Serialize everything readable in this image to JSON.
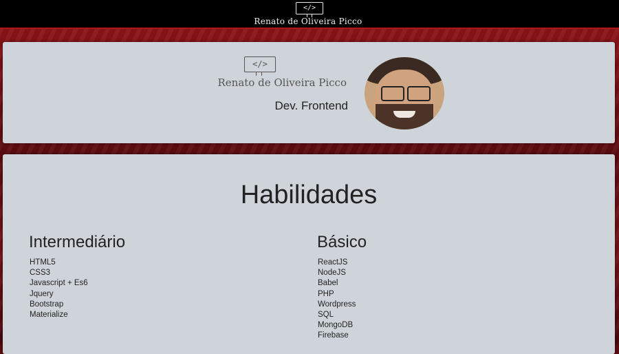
{
  "header": {
    "logo_glyph": "</>",
    "name": "Renato de Oliveira Picco"
  },
  "profile": {
    "logo_glyph": "</>",
    "name": "Renato de Oliveira Picco",
    "role": "Dev. Frontend"
  },
  "skills": {
    "title": "Habilidades",
    "intermediate": {
      "heading": "Intermediário",
      "items": [
        "HTML5",
        "CSS3",
        "Javascript + Es6",
        "Jquery",
        "Bootstrap",
        "Materialize"
      ]
    },
    "basic": {
      "heading": "Básico",
      "items": [
        "ReactJS",
        "NodeJS",
        "Babel",
        "PHP",
        "Wordpress",
        "SQL",
        "MongoDB",
        "Firebase"
      ]
    }
  },
  "colors": {
    "header_bg": "#000000",
    "page_bg": "#5a0d10",
    "card_bg": "#ced4da",
    "accent_border": "#b3141a"
  }
}
